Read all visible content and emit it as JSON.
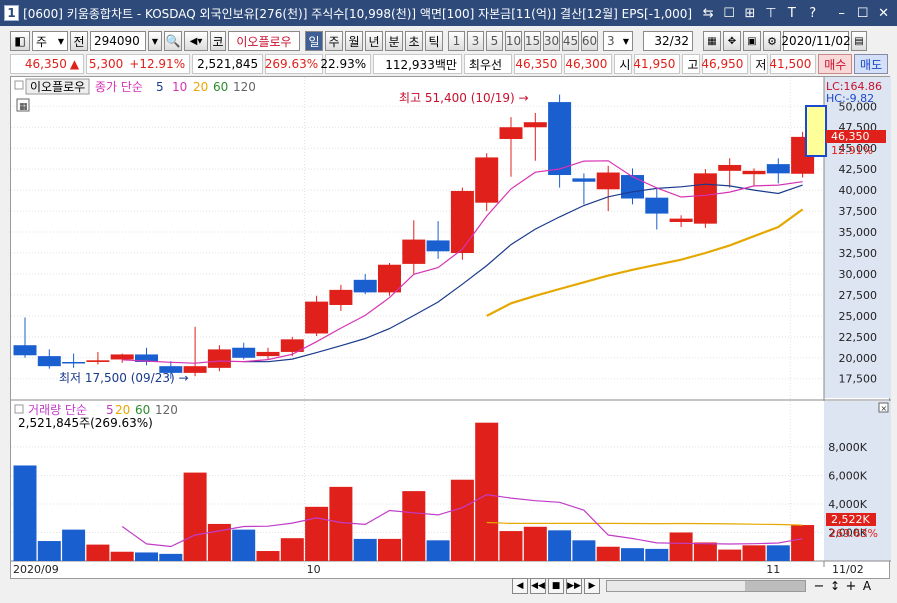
{
  "window": {
    "app_num": "1",
    "title": "[0600] 키움종합차트 - KOSDAQ 외국인보유[276(천)] 주식수[10,998(천)] 액면[100] 자본금[11(억)] 결산[12월] EPS[-1,000] 시가",
    "buttons": [
      "⇆",
      "☐",
      "⊞",
      "⊤",
      "T",
      "?",
      "–",
      "☐",
      "✕"
    ]
  },
  "toolbar": {
    "market_type": "주",
    "prev_label": "전",
    "stock_code": "294090",
    "market_prefix": "코",
    "stock_name": "이오플로우",
    "periods": [
      "일",
      "주",
      "월",
      "년",
      "분",
      "초",
      "틱"
    ],
    "selected_period": "일",
    "intervals": [
      "1",
      "3",
      "5",
      "10",
      "15",
      "30",
      "45",
      "60"
    ],
    "custom_interval": "3",
    "page_indicator": "32/32",
    "date": "2020/11/02"
  },
  "info": {
    "price": "46,350",
    "change_arrow": "▲",
    "change": "5,300",
    "change_pct": "+12.91%",
    "volume": "2,521,845",
    "volume_ratio": "269.63%",
    "turnover": "22.93%",
    "trade_value": "112,933백만",
    "best_ask_label": "최우선",
    "best_ask": "46,350",
    "best_bid": "46,300",
    "open_label": "시",
    "open": "41,950",
    "high_label": "고",
    "high": "46,950",
    "low_label": "저",
    "low": "41,500",
    "buy_label": "매수",
    "sell_label": "매도"
  },
  "price_panel": {
    "stock_label": "이오플로우",
    "indicator_label": "종가 단순",
    "ma_periods": [
      "5",
      "10",
      "20",
      "60",
      "120"
    ],
    "ma_colors": [
      "#1a3a8c",
      "#d633b5",
      "#e5a800",
      "#2b8c2b",
      "#666666"
    ],
    "lc": "LC:164.86",
    "hc": "HC:-9.82",
    "current_price_tag": "46,350",
    "pct_tag": "12.91%",
    "high_annotation": "최고 51,400 (10/19) →",
    "low_annotation": "최저 17,500 (09/23) →",
    "y_ticks": [
      "50,000",
      "47,500",
      "45,000",
      "42,500",
      "40,000",
      "37,500",
      "35,000",
      "32,500",
      "30,000",
      "27,500",
      "25,000",
      "22,500",
      "20,000",
      "17,500"
    ]
  },
  "volume_panel": {
    "label": "거래량 단순",
    "ma_periods": [
      "5",
      "20",
      "60",
      "120"
    ],
    "ma_colors": [
      "#d633b5",
      "#e5a800",
      "#2b8c2b",
      "#666666"
    ],
    "current": "2,521,845주(269.63%)",
    "current_tag": "2,522K",
    "pct_tag": "269.63%",
    "y_ticks": [
      "8,000K",
      "6,000K",
      "4,000K",
      "2,000K"
    ]
  },
  "xaxis": {
    "labels": [
      "2020/09",
      "10",
      "11",
      "11/02"
    ]
  },
  "colors": {
    "up": "#e0201a",
    "down": "#1a5fd0",
    "ma5": "#1a3a8c",
    "ma10": "#d633b5",
    "ma20": "#e5a800",
    "vol_ma5": "#c13cc9",
    "vol_ma20": "#e5a800"
  },
  "chart_data": {
    "type": "candlestick",
    "series_ohlc": [
      [
        21500,
        24800,
        20000,
        20300
      ],
      [
        20200,
        21000,
        18700,
        19000
      ],
      [
        19500,
        20500,
        18800,
        19400
      ],
      [
        19500,
        20700,
        19200,
        19700
      ],
      [
        19800,
        20500,
        19400,
        20400
      ],
      [
        20400,
        21200,
        19100,
        19500
      ],
      [
        19000,
        19600,
        17500,
        18200
      ],
      [
        18200,
        23700,
        17800,
        19000
      ],
      [
        18800,
        21500,
        18400,
        21000
      ],
      [
        21200,
        21800,
        19800,
        20000
      ],
      [
        20200,
        21200,
        19800,
        20700
      ],
      [
        20700,
        22500,
        20200,
        22200
      ],
      [
        22900,
        27400,
        22600,
        26700
      ],
      [
        26300,
        28700,
        25600,
        28100
      ],
      [
        29300,
        30000,
        27600,
        27800
      ],
      [
        27800,
        31300,
        27400,
        31100
      ],
      [
        31200,
        36400,
        30000,
        34100
      ],
      [
        34000,
        36300,
        31800,
        32700
      ],
      [
        32500,
        40300,
        31700,
        39900
      ],
      [
        38500,
        44400,
        37500,
        43900
      ],
      [
        46100,
        48700,
        41600,
        47500
      ],
      [
        47500,
        49200,
        43500,
        48100
      ],
      [
        50500,
        51400,
        40300,
        41800
      ],
      [
        41400,
        42000,
        38300,
        41000
      ],
      [
        40100,
        42900,
        37500,
        42100
      ],
      [
        41800,
        42600,
        38300,
        39000
      ],
      [
        39100,
        40200,
        35300,
        37200
      ],
      [
        36200,
        37000,
        35600,
        36600
      ],
      [
        36000,
        42500,
        35500,
        42000
      ],
      [
        42300,
        43800,
        40300,
        43000
      ],
      [
        41900,
        42600,
        40500,
        42300
      ],
      [
        43100,
        43800,
        40800,
        42000
      ],
      [
        41950,
        46950,
        41500,
        46350
      ]
    ],
    "ma5": [
      null,
      null,
      null,
      null,
      19760,
      19600,
      19460,
      19360,
      19620,
      19540,
      19780,
      20420,
      21920,
      23540,
      25060,
      27180,
      29960,
      30760,
      32960,
      36900,
      40140,
      42140,
      42520,
      43460,
      43500,
      41600,
      40260,
      39180,
      39380,
      39760,
      40500,
      40600,
      41000
    ],
    "ma10": [
      null,
      null,
      null,
      null,
      null,
      null,
      null,
      null,
      null,
      19550,
      19530,
      19840,
      20620,
      21440,
      22300,
      23480,
      25040,
      26660,
      28780,
      31000,
      33500,
      35350,
      36800,
      38160,
      39200,
      39800,
      40200,
      40400,
      40700,
      40500,
      40000,
      39600,
      40600
    ],
    "ma20": [
      null,
      null,
      null,
      null,
      null,
      null,
      null,
      null,
      null,
      null,
      null,
      null,
      null,
      null,
      null,
      null,
      null,
      null,
      null,
      25000,
      26500,
      27400,
      28200,
      29000,
      29800,
      30500,
      31100,
      31700,
      32500,
      33400,
      34500,
      35600,
      37700
    ],
    "volume_k": [
      6700,
      1400,
      2200,
      1150,
      650,
      600,
      500,
      6200,
      2600,
      2200,
      700,
      1600,
      3800,
      5200,
      1550,
      1550,
      4900,
      1450,
      5700,
      9700,
      2100,
      2400,
      2150,
      1450,
      1000,
      900,
      850,
      2000,
      1300,
      800,
      1100,
      1100,
      2522
    ],
    "volume_ma5": [
      null,
      null,
      null,
      null,
      2420,
      1200,
      1020,
      1820,
      2110,
      2420,
      2440,
      2660,
      3020,
      2700,
      2570,
      3540,
      3380,
      3230,
      3740,
      4660,
      4410,
      4230,
      4120,
      3560,
      1820,
      1580,
      1270,
      1240,
      1210,
      1190,
      1210,
      1260,
      1564
    ],
    "volume_ma20": [
      null,
      null,
      null,
      null,
      null,
      null,
      null,
      null,
      null,
      null,
      null,
      null,
      null,
      null,
      null,
      null,
      null,
      null,
      null,
      2700,
      2640,
      2640,
      2640,
      2640,
      2640,
      2630,
      2620,
      2630,
      2620,
      2600,
      2580,
      2560,
      2520
    ],
    "price_ylim": [
      15800,
      52300
    ],
    "volume_ylim": [
      0,
      10800
    ],
    "xlabel": "",
    "ylabel": ""
  }
}
